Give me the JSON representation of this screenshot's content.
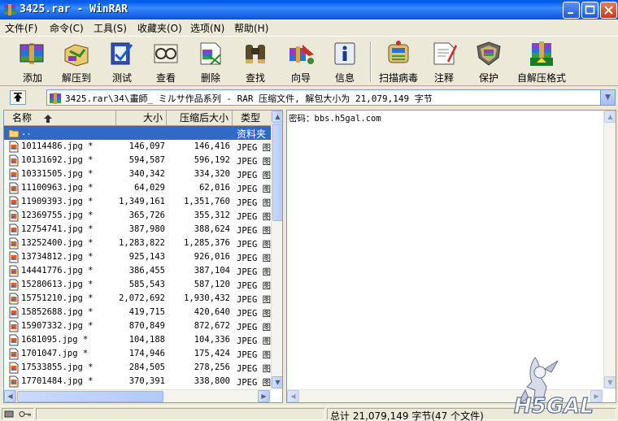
{
  "window": {
    "title": "3425.rar - WinRAR"
  },
  "menu": [
    {
      "label": "文件(F)"
    },
    {
      "label": "命令(C)"
    },
    {
      "label": "工具(S)"
    },
    {
      "label": "收藏夹(O)"
    },
    {
      "label": "选项(N)"
    },
    {
      "label": "帮助(H)"
    }
  ],
  "toolbar": [
    {
      "label": "添加",
      "icon": "add-icon"
    },
    {
      "label": "解压到",
      "icon": "extract-to-icon"
    },
    {
      "label": "测试",
      "icon": "test-icon"
    },
    {
      "label": "查看",
      "icon": "view-icon"
    },
    {
      "label": "删除",
      "icon": "delete-icon"
    },
    {
      "label": "查找",
      "icon": "find-icon"
    },
    {
      "label": "向导",
      "icon": "wizard-icon"
    },
    {
      "label": "信息",
      "icon": "info-icon"
    },
    {
      "label": "扫描病毒",
      "icon": "virus-scan-icon"
    },
    {
      "label": "注释",
      "icon": "comment-icon"
    },
    {
      "label": "保护",
      "icon": "protect-icon"
    },
    {
      "label": "自解压格式",
      "icon": "sfx-icon"
    }
  ],
  "address": {
    "path": "3425.rar\\34\\畫師_ ミルサ作品系列 - RAR 压缩文件, 解包大小为 21,079,149 字节"
  },
  "columns": {
    "name": "名称",
    "size": "大小",
    "packed": "压缩后大小",
    "type": "类型"
  },
  "files": [
    {
      "name": "..",
      "size": "",
      "packed": "",
      "type": "资料夹",
      "selected": true
    },
    {
      "name": "10114486.jpg *",
      "size": "146,097",
      "packed": "146,416",
      "type": "JPEG 图"
    },
    {
      "name": "10131692.jpg *",
      "size": "594,587",
      "packed": "596,192",
      "type": "JPEG 图"
    },
    {
      "name": "10331505.jpg *",
      "size": "340,342",
      "packed": "334,320",
      "type": "JPEG 图"
    },
    {
      "name": "11100963.jpg *",
      "size": "64,029",
      "packed": "62,016",
      "type": "JPEG 图"
    },
    {
      "name": "11909393.jpg *",
      "size": "1,349,161",
      "packed": "1,351,760",
      "type": "JPEG 图"
    },
    {
      "name": "12369755.jpg *",
      "size": "365,726",
      "packed": "355,312",
      "type": "JPEG 图"
    },
    {
      "name": "12754741.jpg *",
      "size": "387,980",
      "packed": "388,624",
      "type": "JPEG 图"
    },
    {
      "name": "13252400.jpg *",
      "size": "1,283,822",
      "packed": "1,285,376",
      "type": "JPEG 图"
    },
    {
      "name": "13734812.jpg *",
      "size": "925,143",
      "packed": "926,016",
      "type": "JPEG 图"
    },
    {
      "name": "14441776.jpg *",
      "size": "386,455",
      "packed": "387,104",
      "type": "JPEG 图"
    },
    {
      "name": "15280613.jpg *",
      "size": "585,543",
      "packed": "587,120",
      "type": "JPEG 图"
    },
    {
      "name": "15751210.jpg *",
      "size": "2,072,692",
      "packed": "1,930,432",
      "type": "JPEG 图"
    },
    {
      "name": "15852688.jpg *",
      "size": "419,715",
      "packed": "420,640",
      "type": "JPEG 图"
    },
    {
      "name": "15907332.jpg *",
      "size": "870,849",
      "packed": "872,672",
      "type": "JPEG 图"
    },
    {
      "name": "1681095.jpg *",
      "size": "104,188",
      "packed": "104,336",
      "type": "JPEG 图"
    },
    {
      "name": "1701047.jpg *",
      "size": "174,946",
      "packed": "175,424",
      "type": "JPEG 图"
    },
    {
      "name": "17533855.jpg *",
      "size": "284,505",
      "packed": "278,256",
      "type": "JPEG 图"
    },
    {
      "name": "17701484.jpg *",
      "size": "370,391",
      "packed": "338,800",
      "type": "JPEG 图"
    }
  ],
  "comment": {
    "text": "密码：bbs.h5gal.com"
  },
  "status": {
    "total": "总计 21,079,149 字节(47 个文件)"
  },
  "watermark": {
    "text": "H5GAL"
  },
  "colors": {
    "title_bar": "#0058EE",
    "selection": "#316AC5",
    "chrome": "#ECE9D8"
  }
}
